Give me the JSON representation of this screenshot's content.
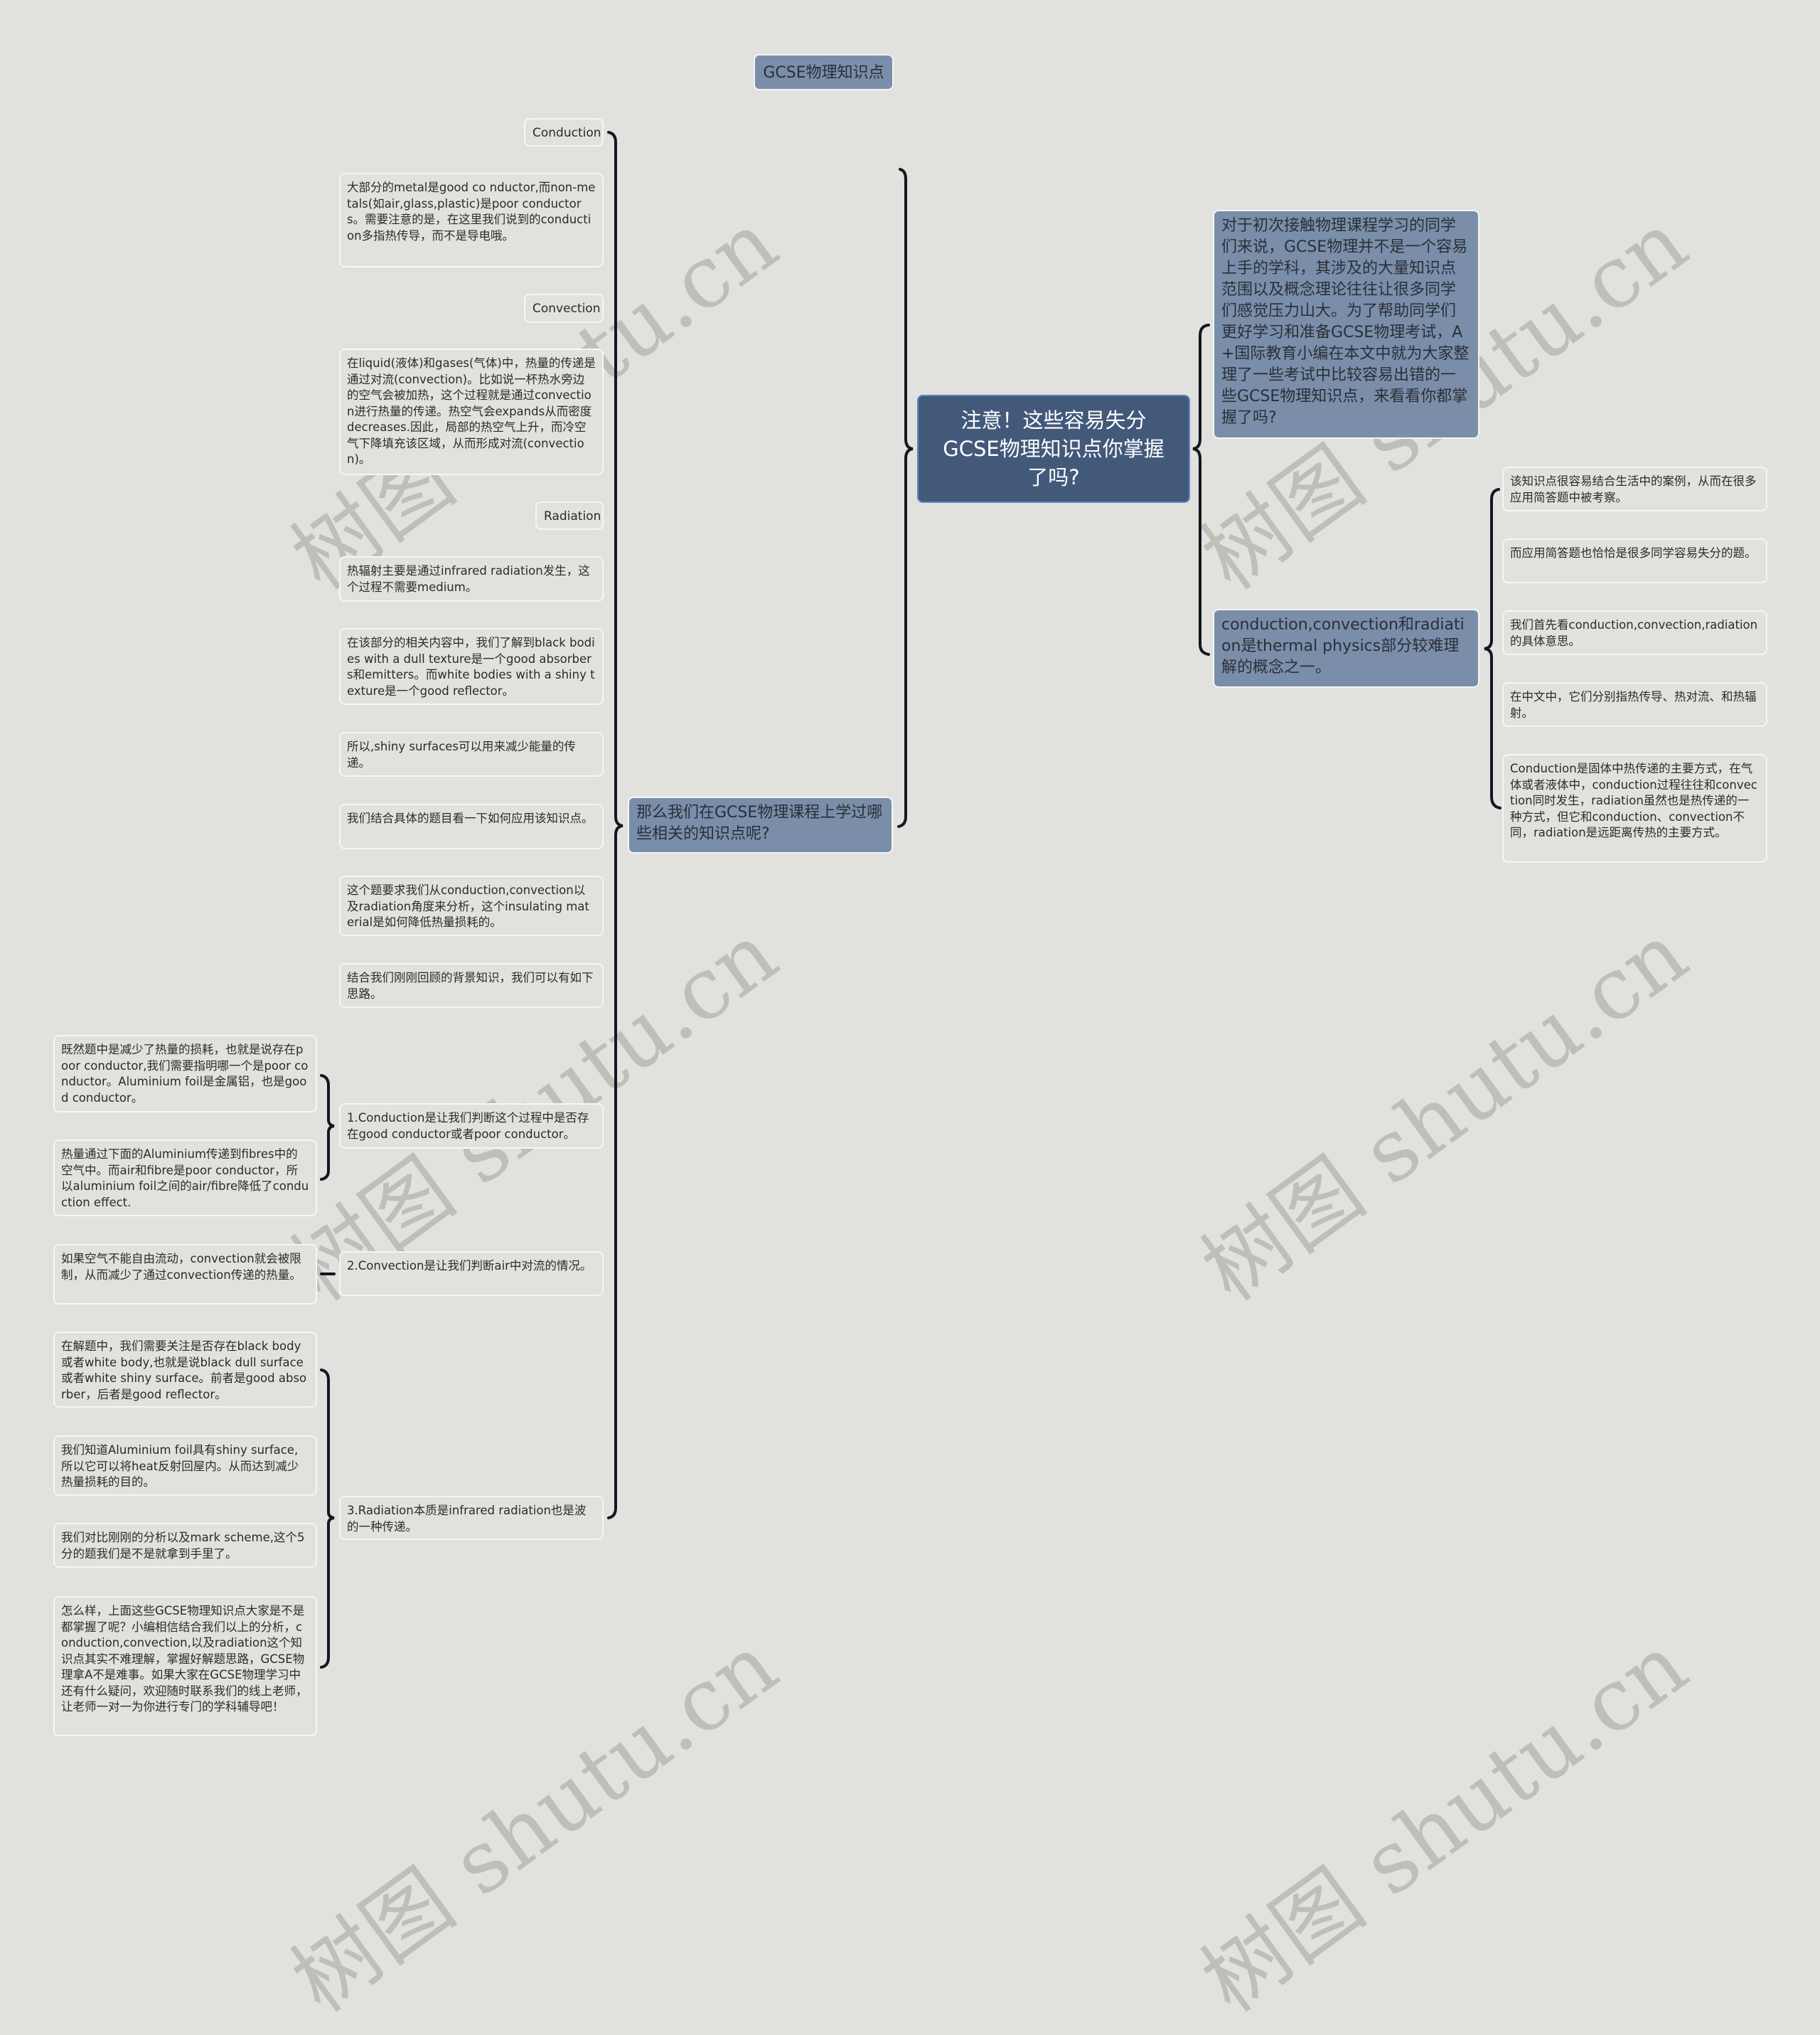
{
  "title": "GCSE物理知识点",
  "root": "注意！这些容易失分GCSE物理知识点你掌握了吗?",
  "watermark": "树图 shutu.cn",
  "right": {
    "intro": "对于初次接触物理课程学习的同学们来说，GCSE物理并不是一个容易上手的学科，其涉及的大量知识点范围以及概念理论往往让很多同学们感觉压力山大。为了帮助同学们更好学习和准备GCSE物理考试，A+国际教育小编在本文中就为大家整理了一些考试中比较容易出错的一些GCSE物理知识点，来看看你都掌握了吗?",
    "concept": "conduction,convection和radiation是thermal physics部分较难理解的概念之一。",
    "concept_children": [
      "该知识点很容易结合生活中的案例，从而在很多应用简答题中被考察。",
      "而应用简答题也恰恰是很多同学容易失分的题。",
      "我们首先看conduction,convection,radiation的具体意思。",
      "在中文中，它们分别指热传导、热对流、和热辐射。",
      "Conduction是固体中热传递的主要方式，在气体或者液体中，conduction过程往往和convection同时发生，radiation虽然也是热传递的一种方式，但它和conduction、convection不同，radiation是远距离传热的主要方式。"
    ]
  },
  "left": {
    "branch": "那么我们在GCSE物理课程上学过哪些相关的知识点呢?",
    "children": [
      {
        "type": "label",
        "text": "Conduction"
      },
      {
        "type": "leaf",
        "text": "大部分的metal是good co nductor,而non-metals(如air,glass,plastic)是poor conductors。需要注意的是，在这里我们说到的conduction多指热传导，而不是导电哦。"
      },
      {
        "type": "label",
        "text": "Convection"
      },
      {
        "type": "leaf",
        "text": "在liquid(液体)和gases(气体)中，热量的传递是通过对流(convection)。比如说一杯热水旁边的空气会被加热，这个过程就是通过convection进行热量的传递。热空气会expands从而密度decreases.因此，局部的热空气上升，而冷空气下降填充该区域，从而形成对流(convection)。"
      },
      {
        "type": "label",
        "text": "Radiation"
      },
      {
        "type": "leaf",
        "text": "热辐射主要是通过infrared radiation发生，这个过程不需要medium。"
      },
      {
        "type": "leaf",
        "text": "在该部分的相关内容中，我们了解到black bodies with a dull texture是一个good absorbers和emitters。而white bodies with a shiny texture是一个good reflector。"
      },
      {
        "type": "leaf",
        "text": "所以,shiny surfaces可以用来减少能量的传递。"
      },
      {
        "type": "leaf",
        "text": "我们结合具体的题目看一下如何应用该知识点。"
      },
      {
        "type": "leaf",
        "text": "这个题要求我们从conduction,convection以及radiation角度来分析，这个insulating material是如何降低热量损耗的。"
      },
      {
        "type": "leaf",
        "text": "结合我们刚刚回顾的背景知识，我们可以有如下思路。"
      },
      {
        "type": "leaf",
        "text": "1.Conduction是让我们判断这个过程中是否存在good conductor或者poor conductor。"
      },
      {
        "type": "leaf",
        "text": "2.Convection是让我们判断air中对流的情况。"
      },
      {
        "type": "leaf",
        "text": "3.Radiation本质是infrared radiation也是波的一种传递。"
      }
    ],
    "step1_children": [
      "既然题中是减少了热量的损耗，也就是说存在poor conductor,我们需要指明哪一个是poor conductor。Aluminium foil是金属铝，也是good conductor。",
      "热量通过下面的Aluminium传递到fibres中的空气中。而air和fibre是poor conductor，所以aluminium foil之间的air/fibre降低了conduction effect."
    ],
    "step2_children": [
      "如果空气不能自由流动，convection就会被限制，从而减少了通过convection传递的热量。"
    ],
    "step3_children": [
      "在解题中，我们需要关注是否存在black body或者white body,也就是说black dull surface或者white shiny surface。前者是good absorber，后者是good reflector。",
      "我们知道Aluminium foil具有shiny surface,所以它可以将heat反射回屋内。从而达到减少热量损耗的目的。",
      "我们对比刚刚的分析以及mark scheme,这个5分的题我们是不是就拿到手里了。",
      "怎么样，上面这些GCSE物理知识点大家是不是都掌握了呢？小编相信结合我们以上的分析，conduction,convection,以及radiation这个知识点其实不难理解，掌握好解题思路，GCSE物理拿A不是难事。如果大家在GCSE物理学习中还有什么疑问，欢迎随时联系我们的线上老师，让老师一对一为你进行专门的学科辅导吧！"
    ]
  }
}
